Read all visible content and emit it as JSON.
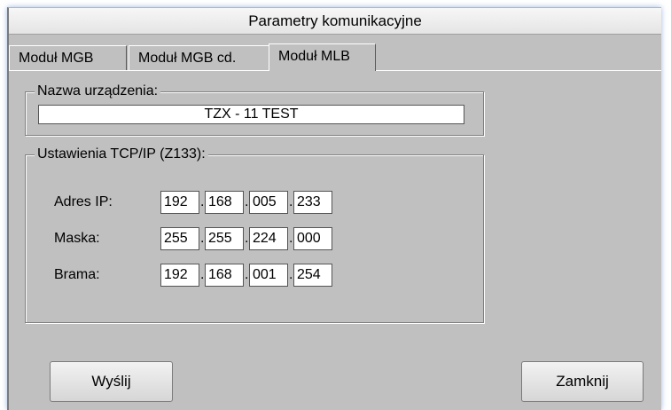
{
  "window": {
    "title": "Parametry komunikacyjne"
  },
  "tabs": [
    {
      "label": "Moduł MGB",
      "active": false
    },
    {
      "label": "Moduł MGB cd.",
      "active": false
    },
    {
      "label": "Moduł MLB",
      "active": true
    }
  ],
  "device_name": {
    "legend": "Nazwa urządzenia:",
    "value": "TZX - 11 TEST"
  },
  "tcp": {
    "legend": "Ustawienia TCP/IP (Z133):",
    "rows": [
      {
        "label": "Adres IP:",
        "octets": [
          "192",
          "168",
          "005",
          "233"
        ]
      },
      {
        "label": "Maska:",
        "octets": [
          "255",
          "255",
          "224",
          "000"
        ]
      },
      {
        "label": "Brama:",
        "octets": [
          "192",
          "168",
          "001",
          "254"
        ]
      }
    ],
    "separator": "."
  },
  "buttons": {
    "send": "Wyślij",
    "close": "Zamknij"
  }
}
